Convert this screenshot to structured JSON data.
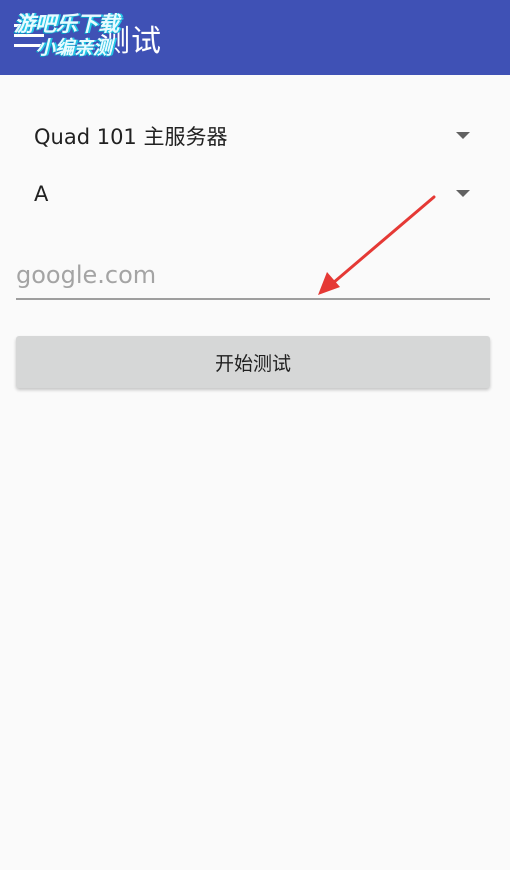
{
  "toolbar": {
    "title": "测试",
    "menu_icon": "hamburger-menu-icon",
    "background_color": "#3f51b5"
  },
  "watermark": {
    "line1": "游吧乐下载",
    "line2": "小编亲测"
  },
  "server_spinner": {
    "selected": "Quad 101 主服务器",
    "icon": "dropdown-arrow-icon"
  },
  "type_spinner": {
    "selected": "A",
    "icon": "dropdown-arrow-icon"
  },
  "domain_input": {
    "placeholder": "google.com",
    "value": ""
  },
  "start_button": {
    "label": "开始测试"
  },
  "annotation": {
    "color": "#e53935",
    "icon": "red-arrow-annotation"
  }
}
